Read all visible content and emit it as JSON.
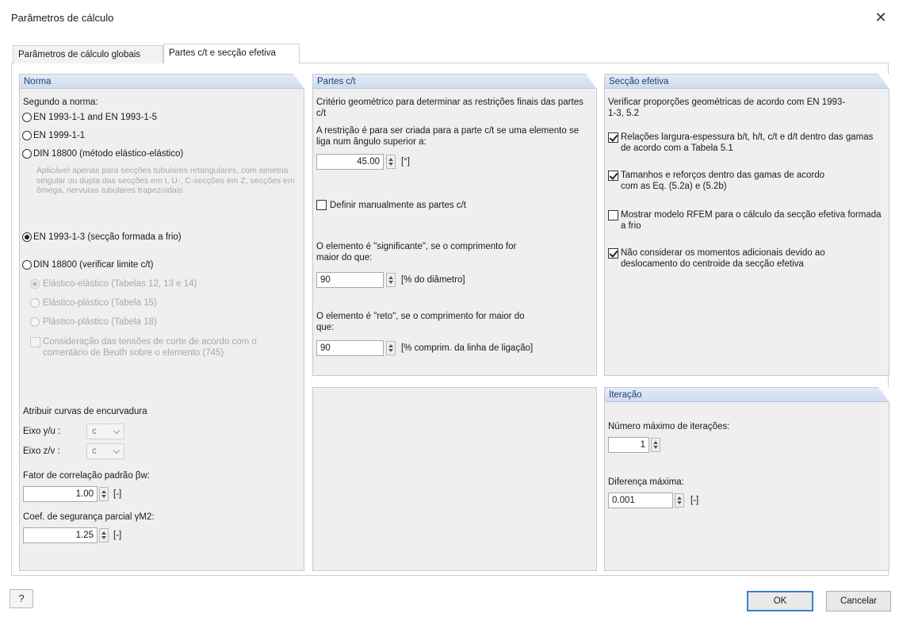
{
  "window": {
    "title": "Parâmetros de cálculo",
    "close_glyph": "✕"
  },
  "tabs": [
    {
      "label": "Parâmetros de cálculo globais",
      "active": false
    },
    {
      "label": "Partes c/t e secção efetiva",
      "active": true
    }
  ],
  "norma": {
    "header": "Norma",
    "intro": "Segundo a norma:",
    "options": [
      {
        "label": "EN 1993-1-1 and EN 1993-1-5",
        "checked": false
      },
      {
        "label": "EN 1999-1-1",
        "checked": false
      },
      {
        "label": "DIN 18800 (método elástico-elástico)",
        "checked": false
      },
      {
        "label": "EN 1993-1-3 (secção formada a frio)",
        "checked": true
      },
      {
        "label": "DIN 18800 (verificar limite c/t)",
        "checked": false
      }
    ],
    "din_note": "Aplicável apenas para secções tubulares retangulares, com simetria singular ou dupla das secções em I, U-, C-secções em Z, secções em ômega, nervuras tubulares trapezoidais",
    "din_sub": [
      {
        "label": "Elástico-elástico (Tabelas 12, 13 e 14)",
        "checked": true
      },
      {
        "label": "Elástico-plástico (Tabela 15)",
        "checked": false
      },
      {
        "label": "Plástico-plástico (Tabela 18)",
        "checked": false
      }
    ],
    "din_shear": "Consideração das tensões de corte de acordo com o comentário de Beuth sobre o elemento (745)",
    "buckling_title": "Atribuir curvas de encurvadura",
    "axis_yu_label": "Eixo y/u :",
    "axis_yu_value": "c",
    "axis_zv_label": "Eixo z/v :",
    "axis_zv_value": "c",
    "corr_label": "Fator de correlação padrão βw:",
    "corr_value": "1.00",
    "corr_unit": "[-]",
    "safety_label": "Coef. de segurança parcial γM2:",
    "safety_value": "1.25",
    "safety_unit": "[-]"
  },
  "partes": {
    "header": "Partes c/t",
    "criterion": "Critério geométrico para determinar as restrições finais das partes c/t",
    "restriction_label": "A restrição é para ser criada para a parte c/t se uma elemento se liga num ângulo superior a:",
    "angle_value": "45.00",
    "angle_unit": "[°]",
    "manual_label": "Definir manualmente as partes c/t",
    "manual_checked": false,
    "significant_label": "O elemento é \"significante\", se o comprimento for maior do que:",
    "significant_value": "90",
    "significant_unit": "[% do diâmetro]",
    "straight_label": "O elemento é \"reto\", se o comprimento for maior do que:",
    "straight_value": "90",
    "straight_unit": "[% comprim. da linha de ligação]"
  },
  "seccao": {
    "header": "Secção efetiva",
    "intro": "Verificar proporções geométricas de acordo com EN 1993-1-3, 5.2",
    "checks": [
      {
        "label": "Relações largura-espessura b/t, h/t, c/t e d/t dentro das gamas de acordo com a Tabela 5.1",
        "checked": true
      },
      {
        "label": "Tamanhos e reforços dentro das gamas de acordo com as Eq. (5.2a) e (5.2b)",
        "checked": true
      },
      {
        "label": "Mostrar modelo RFEM para o cálculo da secção efetiva formada a frio",
        "checked": false
      },
      {
        "label": "Não considerar os momentos adicionais devido ao deslocamento do centroide da secção efetiva",
        "checked": true
      }
    ]
  },
  "iteracao": {
    "header": "Iteração",
    "max_label": "Número máximo de iterações:",
    "max_value": "1",
    "diff_label": "Diferença máxima:",
    "diff_value": "0.001",
    "diff_unit": "[-]"
  },
  "footer": {
    "help_glyph": "?",
    "ok_label": "OK",
    "cancel_label": "Cancelar"
  }
}
